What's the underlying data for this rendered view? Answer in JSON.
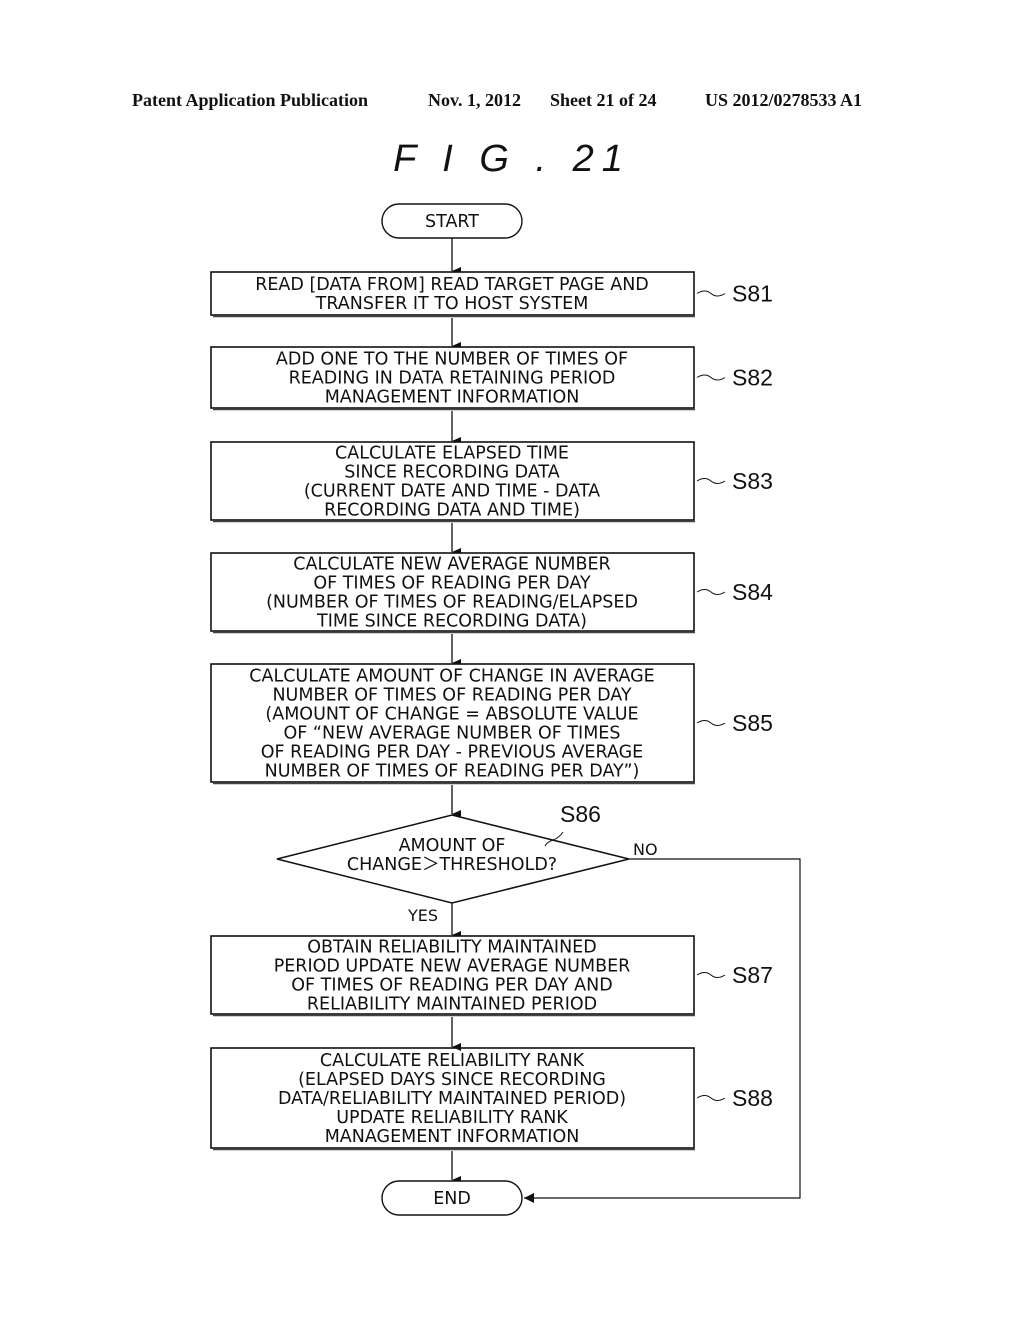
{
  "header": {
    "publication": "Patent Application Publication",
    "date": "Nov. 1, 2012",
    "sheet": "Sheet 21 of 24",
    "number": "US 2012/0278533 A1"
  },
  "figure": {
    "title": "F I G . 21"
  },
  "flowchart": {
    "start": "START",
    "end": "END",
    "steps": [
      {
        "id": "S81",
        "lines": [
          "READ [DATA FROM] READ TARGET PAGE AND",
          "TRANSFER IT TO HOST SYSTEM"
        ]
      },
      {
        "id": "S82",
        "lines": [
          "ADD ONE TO THE NUMBER OF TIMES OF",
          "READING IN DATA RETAINING PERIOD",
          "MANAGEMENT INFORMATION"
        ]
      },
      {
        "id": "S83",
        "lines": [
          "CALCULATE ELAPSED TIME",
          "SINCE RECORDING DATA",
          "(CURRENT DATE AND TIME - DATA",
          "RECORDING DATA AND TIME)"
        ]
      },
      {
        "id": "S84",
        "lines": [
          "CALCULATE NEW AVERAGE NUMBER",
          "OF TIMES OF READING PER DAY",
          "(NUMBER OF TIMES OF READING/ELAPSED",
          "TIME SINCE RECORDING DATA)"
        ]
      },
      {
        "id": "S85",
        "lines": [
          "CALCULATE AMOUNT OF CHANGE IN AVERAGE",
          "NUMBER OF TIMES OF READING PER DAY",
          "(AMOUNT OF CHANGE = ABSOLUTE VALUE",
          "OF “NEW AVERAGE NUMBER OF TIMES",
          "OF READING PER DAY - PREVIOUS AVERAGE",
          "NUMBER OF TIMES OF READING PER DAY”)"
        ]
      }
    ],
    "decision": {
      "id": "S86",
      "lines": [
        "AMOUNT OF",
        "CHANGE＞THRESHOLD?"
      ],
      "yes": "YES",
      "no": "NO"
    },
    "after": [
      {
        "id": "S87",
        "lines": [
          "OBTAIN RELIABILITY MAINTAINED",
          "PERIOD UPDATE NEW AVERAGE NUMBER",
          "OF TIMES OF READING PER DAY AND",
          "RELIABILITY MAINTAINED PERIOD"
        ]
      },
      {
        "id": "S88",
        "lines": [
          "CALCULATE RELIABILITY RANK",
          "(ELAPSED DAYS SINCE RECORDING",
          "DATA/RELIABILITY MAINTAINED PERIOD)",
          "UPDATE RELIABILITY RANK",
          "MANAGEMENT INFORMATION"
        ]
      }
    ]
  }
}
